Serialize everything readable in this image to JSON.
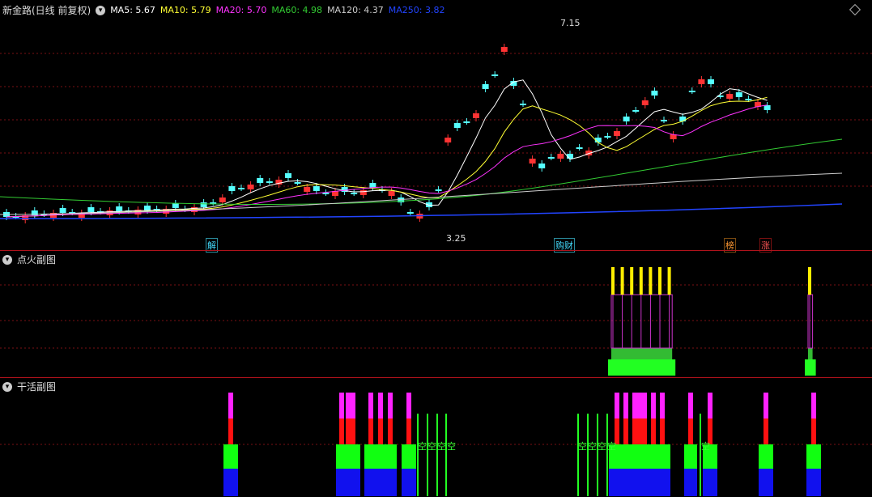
{
  "main": {
    "title": "新金路(日线 前复权)",
    "ma": [
      {
        "label": "MA5: 5.67",
        "color": "#ffffff"
      },
      {
        "label": "MA10: 5.79",
        "color": "#ffff33"
      },
      {
        "label": "MA20: 5.70",
        "color": "#ff33ff"
      },
      {
        "label": "MA60: 4.98",
        "color": "#33cc33"
      },
      {
        "label": "MA120: 4.37",
        "color": "#cccccc"
      },
      {
        "label": "MA250: 3.82",
        "color": "#2244ff"
      }
    ],
    "high_label": "7.15",
    "low_label": "3.25",
    "markers": [
      {
        "text": "解",
        "color": "#44ddff"
      },
      {
        "text": "财",
        "color": "#44ddff"
      },
      {
        "text": "榜",
        "color": "#ff9933"
      },
      {
        "text": "涨",
        "color": "#ff5555"
      }
    ]
  },
  "sub1": {
    "title": "点火副图"
  },
  "sub2": {
    "title": "干活副图",
    "kong": "空"
  },
  "colors": {
    "up": "#ff3333",
    "down": "#55ffff",
    "grid": "#7a0f14"
  }
}
